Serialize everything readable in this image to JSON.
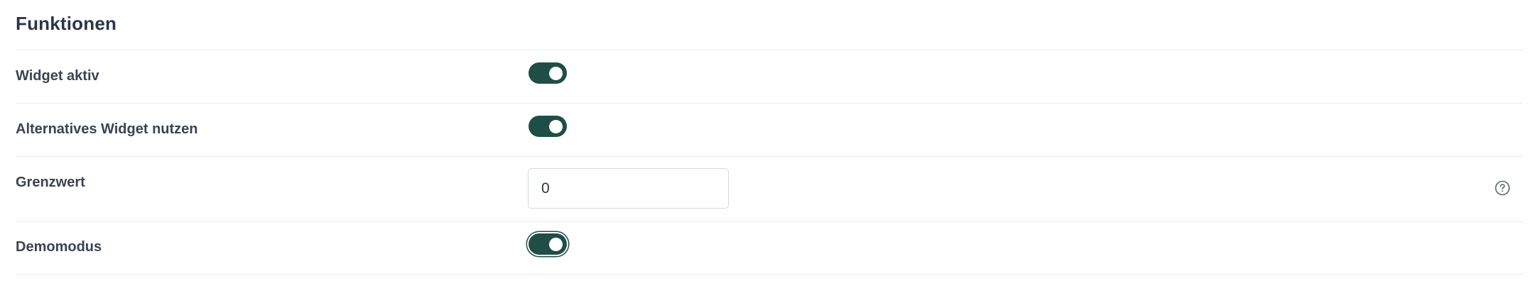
{
  "section": {
    "title": "Funktionen"
  },
  "settings": {
    "widget_active": {
      "label": "Widget aktiv",
      "enabled": true
    },
    "alternative_widget": {
      "label": "Alternatives Widget nutzen",
      "enabled": true
    },
    "threshold": {
      "label": "Grenzwert",
      "value": "0",
      "help_icon": "question-circle-icon"
    },
    "demo_mode": {
      "label": "Demomodus",
      "enabled": true
    }
  },
  "colors": {
    "toggle_on": "#1f4e47",
    "divider": "#e8ebee",
    "text": "#3a4452"
  }
}
